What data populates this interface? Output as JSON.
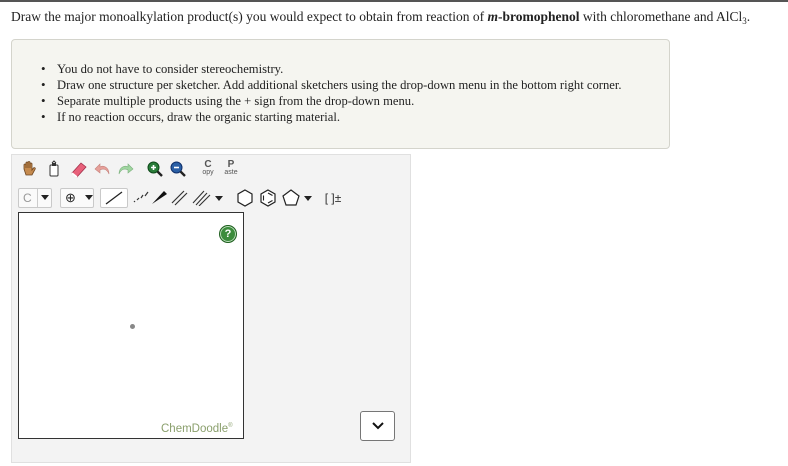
{
  "question": {
    "prefix": "Draw the major monoalkylation product(s) you would expect to obtain from reaction of ",
    "italic": "m",
    "bold": "-bromophenol",
    "suffix": " with chloromethane and AlCl",
    "subscript": "3",
    "end": "."
  },
  "instructions": [
    "You do not have to consider stereochemistry.",
    "Draw one structure per sketcher. Add additional sketchers using the drop-down menu in the bottom right corner.",
    "Separate multiple products using the + sign from the drop-down menu.",
    "If no reaction occurs, draw the organic starting material."
  ],
  "toolbar": {
    "copy_top": "C",
    "copy_bottom": "opy",
    "paste_top": "P",
    "paste_bottom": "aste",
    "atom_label": "C",
    "charge_label": "⊕",
    "bracket_label": "[ ]±"
  },
  "canvas": {
    "help_label": "?",
    "brand": "ChemDoodle",
    "brand_mark": "®"
  },
  "select": {
    "arrow": "⌄"
  }
}
